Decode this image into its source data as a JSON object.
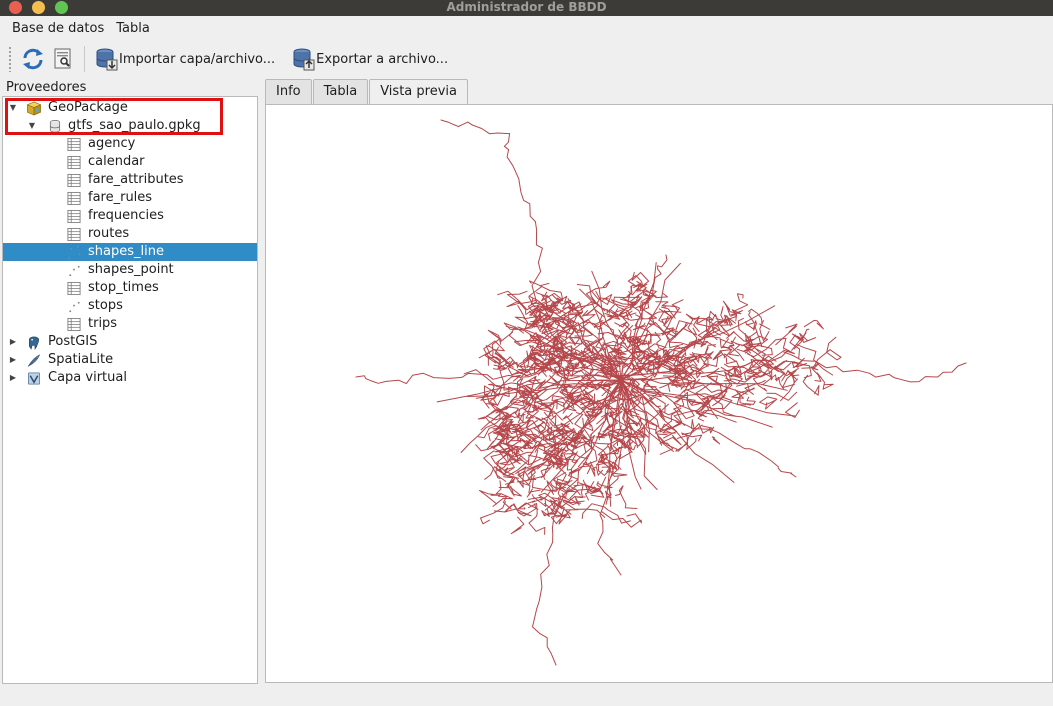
{
  "window": {
    "title": "Administrador de BBDD"
  },
  "menubar": {
    "items": [
      {
        "label": "Base de datos"
      },
      {
        "label": "Tabla"
      }
    ]
  },
  "toolbar": {
    "refresh_icon": "refresh-icon",
    "filter_icon": "filter-icon",
    "import_label": "Importar capa/archivo...",
    "export_label": "Exportar a archivo..."
  },
  "providers": {
    "header": "Proveedores",
    "geopackage": {
      "label": "GeoPackage",
      "file": "gtfs_sao_paulo.gpkg",
      "tables": [
        {
          "label": "agency",
          "kind": "table"
        },
        {
          "label": "calendar",
          "kind": "table"
        },
        {
          "label": "fare_attributes",
          "kind": "table"
        },
        {
          "label": "fare_rules",
          "kind": "table"
        },
        {
          "label": "frequencies",
          "kind": "table"
        },
        {
          "label": "routes",
          "kind": "table"
        },
        {
          "label": "shapes_line",
          "kind": "line"
        },
        {
          "label": "shapes_point",
          "kind": "point"
        },
        {
          "label": "stop_times",
          "kind": "table"
        },
        {
          "label": "stops",
          "kind": "point"
        },
        {
          "label": "trips",
          "kind": "table"
        }
      ],
      "selected": "shapes_line"
    },
    "others": [
      {
        "label": "PostGIS"
      },
      {
        "label": "SpatiaLite"
      },
      {
        "label": "Capa virtual"
      }
    ]
  },
  "tabs": [
    {
      "label": "Info",
      "active": false
    },
    {
      "label": "Tabla",
      "active": false
    },
    {
      "label": "Vista previa",
      "active": true
    }
  ],
  "preview": {
    "line_color": "#b5474b"
  },
  "colors": {
    "selection": "#308cc6",
    "highlight_box": "#e01010"
  }
}
